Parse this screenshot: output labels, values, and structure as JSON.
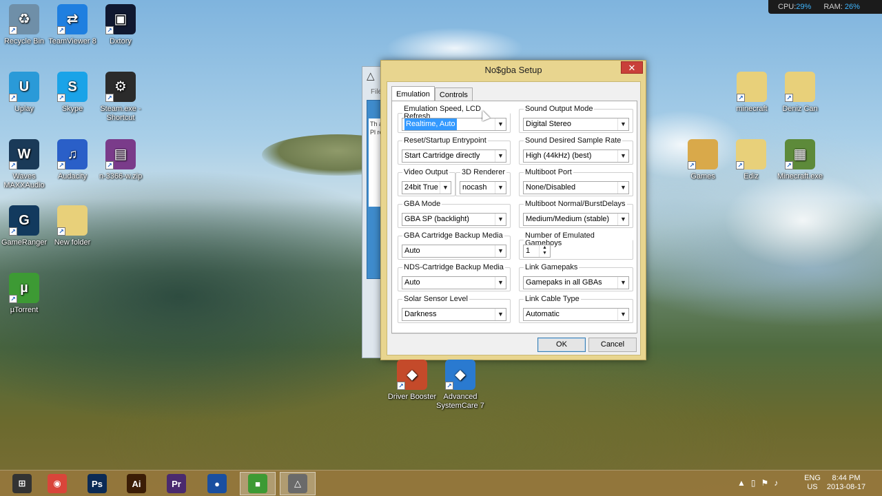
{
  "desktop": {
    "icons_left": [
      {
        "label": "Recycle Bin",
        "icon": "recycle-bin-icon",
        "color": "#6f8fa8",
        "glyph": "♻"
      },
      {
        "label": "TeamViewer 8",
        "icon": "teamviewer-icon",
        "color": "#1f7fe0",
        "glyph": "⇄"
      },
      {
        "label": "Dxtory",
        "icon": "dxtory-icon",
        "color": "#101830",
        "glyph": "▣"
      },
      {
        "label": "Uplay",
        "icon": "uplay-icon",
        "color": "#2a9ad8",
        "glyph": "U"
      },
      {
        "label": "Skype",
        "icon": "skype-icon",
        "color": "#1aa3e8",
        "glyph": "S"
      },
      {
        "label": "Steam.exe - Shortcut",
        "icon": "steam-icon",
        "color": "#2b2b2b",
        "glyph": "⚙"
      },
      {
        "label": "Waves MAXXAudio",
        "icon": "waves-maxxaudio-icon",
        "color": "#1a3a58",
        "glyph": "W"
      },
      {
        "label": "Audacity",
        "icon": "audacity-icon",
        "color": "#2a5fc8",
        "glyph": "♫"
      },
      {
        "label": "n-3366-w.zip",
        "icon": "winrar-archive-icon",
        "color": "#7a3b8a",
        "glyph": "▤"
      },
      {
        "label": "GameRanger",
        "icon": "gameranger-icon",
        "color": "#123a5e",
        "glyph": "G"
      },
      {
        "label": "New folder",
        "icon": "folder-icon",
        "color": "#e8d07a",
        "glyph": ""
      },
      {
        "label": "µTorrent",
        "icon": "utorrent-icon",
        "color": "#3d9a34",
        "glyph": "µ"
      }
    ],
    "icons_right": [
      {
        "label": "minecraft",
        "icon": "folder-icon",
        "color": "#e8d07a",
        "glyph": ""
      },
      {
        "label": "Deniz Can",
        "icon": "folder-icon",
        "color": "#e8d07a",
        "glyph": ""
      },
      {
        "label": "Games",
        "icon": "folder-icon",
        "color": "#d9a94a",
        "glyph": ""
      },
      {
        "label": "Ediz",
        "icon": "folder-icon",
        "color": "#e8d07a",
        "glyph": ""
      },
      {
        "label": "Minecraft.exe",
        "icon": "minecraft-icon",
        "color": "#5d8a3a",
        "glyph": "▦"
      }
    ],
    "icons_bottom": [
      {
        "label": "Driver Booster",
        "icon": "driver-booster-icon",
        "color": "#c44a2a",
        "glyph": "◆"
      },
      {
        "label": "Advanced SystemCare 7",
        "icon": "advanced-systemcare-icon",
        "color": "#2a7ad0",
        "glyph": "◆"
      }
    ]
  },
  "meter": {
    "cpu_label": "CPU:",
    "cpu_value": "29%",
    "ram_label": "RAM:",
    "ram_value": "26%"
  },
  "bgwindow": {
    "menu": "File",
    "text": "Th ac Pl re"
  },
  "dialog": {
    "title": "No$gba Setup",
    "close_glyph": "✕",
    "tabs": [
      "Emulation",
      "Controls"
    ],
    "groups": [
      {
        "legend": "Emulation Speed, LCD Refresh",
        "value": "Realtime, Auto",
        "selected": true
      },
      {
        "legend": "Sound Output Mode",
        "value": "Digital Stereo"
      },
      {
        "legend": "Reset/Startup Entrypoint",
        "value": "Start Cartridge directly"
      },
      {
        "legend": "Sound Desired Sample Rate",
        "value": "High (44kHz) (best)"
      },
      {
        "legend": "Video Output",
        "value": "24bit True"
      },
      {
        "legend": "3D Renderer",
        "value": "nocash"
      },
      {
        "legend": "Multiboot Port",
        "value": "None/Disabled"
      },
      {
        "legend": "GBA Mode",
        "value": "GBA SP (backlight)"
      },
      {
        "legend": "Multiboot Normal/BurstDelays",
        "value": "Medium/Medium (stable)"
      },
      {
        "legend": "GBA Cartridge Backup Media",
        "value": "Auto"
      },
      {
        "legend": "Number of Emulated Gameboys",
        "value": "1"
      },
      {
        "legend": "NDS-Cartridge Backup Media",
        "value": "Auto"
      },
      {
        "legend": "Link Gamepaks",
        "value": "Gamepaks in all GBAs"
      },
      {
        "legend": "Solar Sensor Level",
        "value": "Darkness"
      },
      {
        "legend": "Link Cable Type",
        "value": "Automatic"
      }
    ],
    "ok_label": "OK",
    "cancel_label": "Cancel"
  },
  "taskbar": {
    "buttons": [
      {
        "name": "start-button",
        "icon": "windows-logo-icon",
        "color": "#333",
        "glyph": "⊞"
      },
      {
        "name": "chrome-button",
        "icon": "chrome-icon",
        "color": "#d9453a",
        "glyph": "◉"
      },
      {
        "name": "photoshop-button",
        "icon": "photoshop-icon",
        "color": "#0b2a55",
        "glyph": "Ps"
      },
      {
        "name": "illustrator-button",
        "icon": "illustrator-icon",
        "color": "#3b1d06",
        "glyph": "Ai"
      },
      {
        "name": "premiere-button",
        "icon": "premiere-icon",
        "color": "#4a2a6e",
        "glyph": "Pr"
      },
      {
        "name": "globe-app-button",
        "icon": "globe-icon",
        "color": "#1a4fa0",
        "glyph": "●"
      },
      {
        "name": "dxtory-taskbar-button",
        "icon": "camera-icon",
        "color": "#3d9a34",
        "glyph": "■"
      },
      {
        "name": "nogba-taskbar-button",
        "icon": "nogba-icon",
        "color": "#6a6a6a",
        "glyph": "△"
      }
    ],
    "tray_icons": [
      "▲",
      "▯",
      "⚑",
      "♪"
    ],
    "lang_top": "ENG",
    "lang_bottom": "US",
    "time": "8:44 PM",
    "date": "2013-08-17"
  }
}
